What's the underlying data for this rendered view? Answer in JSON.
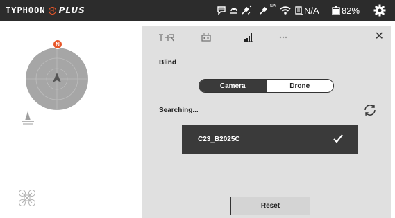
{
  "brand": {
    "left_text": "TYPHOON",
    "h_letter": "H",
    "right_text": "PLUS"
  },
  "status_bar": {
    "gps_value_small": "N/A",
    "gps_text": "N/A",
    "battery_text": "82%",
    "battery_level": 0.82
  },
  "compass": {
    "north_label": "N"
  },
  "panel": {
    "tabs": [
      "flight-settings",
      "controller",
      "signal",
      "more"
    ],
    "active_tab": "signal",
    "section_title": "Blind",
    "segment": {
      "options": [
        "Camera",
        "Drone"
      ],
      "selected": "Camera"
    },
    "searching_label": "Searching...",
    "device_name": "C23_B2025C",
    "reset_label": "Reset"
  },
  "colors": {
    "topbar": "#2c2c2c",
    "panel": "#e0e0e0",
    "accent": "#e8572a",
    "dark_button": "#3a3a3a"
  }
}
